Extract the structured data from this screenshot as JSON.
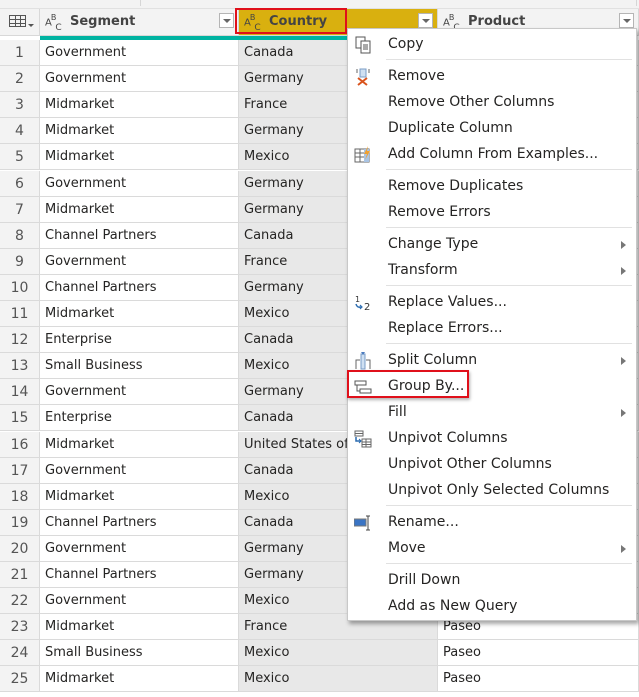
{
  "columns": [
    {
      "name": "Segment",
      "type_icon": "abc-text-type-icon"
    },
    {
      "name": "Country",
      "type_icon": "abc-text-type-icon",
      "selected": true
    },
    {
      "name": "Product",
      "type_icon": "abc-text-type-icon"
    }
  ],
  "type_label": {
    "a": "A",
    "b": "B",
    "c": "C"
  },
  "rows": [
    {
      "n": "1",
      "segment": "Government",
      "country": "Canada",
      "product": ""
    },
    {
      "n": "2",
      "segment": "Government",
      "country": "Germany",
      "product": ""
    },
    {
      "n": "3",
      "segment": "Midmarket",
      "country": "France",
      "product": ""
    },
    {
      "n": "4",
      "segment": "Midmarket",
      "country": "Germany",
      "product": ""
    },
    {
      "n": "5",
      "segment": "Midmarket",
      "country": "Mexico",
      "product": ""
    },
    {
      "n": "6",
      "segment": "Government",
      "country": "Germany",
      "product": ""
    },
    {
      "n": "7",
      "segment": "Midmarket",
      "country": "Germany",
      "product": ""
    },
    {
      "n": "8",
      "segment": "Channel Partners",
      "country": "Canada",
      "product": ""
    },
    {
      "n": "9",
      "segment": "Government",
      "country": "France",
      "product": ""
    },
    {
      "n": "10",
      "segment": "Channel Partners",
      "country": "Germany",
      "product": ""
    },
    {
      "n": "11",
      "segment": "Midmarket",
      "country": "Mexico",
      "product": ""
    },
    {
      "n": "12",
      "segment": "Enterprise",
      "country": "Canada",
      "product": ""
    },
    {
      "n": "13",
      "segment": "Small Business",
      "country": "Mexico",
      "product": ""
    },
    {
      "n": "14",
      "segment": "Government",
      "country": "Germany",
      "product": ""
    },
    {
      "n": "15",
      "segment": "Enterprise",
      "country": "Canada",
      "product": ""
    },
    {
      "n": "16",
      "segment": "Midmarket",
      "country": "United States of America",
      "product": ""
    },
    {
      "n": "17",
      "segment": "Government",
      "country": "Canada",
      "product": ""
    },
    {
      "n": "18",
      "segment": "Midmarket",
      "country": "Mexico",
      "product": ""
    },
    {
      "n": "19",
      "segment": "Channel Partners",
      "country": "Canada",
      "product": ""
    },
    {
      "n": "20",
      "segment": "Government",
      "country": "Germany",
      "product": ""
    },
    {
      "n": "21",
      "segment": "Channel Partners",
      "country": "Germany",
      "product": ""
    },
    {
      "n": "22",
      "segment": "Government",
      "country": "Mexico",
      "product": ""
    },
    {
      "n": "23",
      "segment": "Midmarket",
      "country": "France",
      "product": "Paseo"
    },
    {
      "n": "24",
      "segment": "Small Business",
      "country": "Mexico",
      "product": "Paseo"
    },
    {
      "n": "25",
      "segment": "Midmarket",
      "country": "Mexico",
      "product": "Paseo"
    }
  ],
  "context_menu": {
    "items": [
      {
        "label": "Copy",
        "icon": "copy-icon"
      },
      {
        "label": "Remove",
        "icon": "remove-column-icon"
      },
      {
        "label": "Remove Other Columns"
      },
      {
        "label": "Duplicate Column"
      },
      {
        "label": "Add Column From Examples...",
        "icon": "column-from-examples-icon"
      },
      {
        "label": "Remove Duplicates"
      },
      {
        "label": "Remove Errors"
      },
      {
        "label": "Change Type",
        "submenu": true
      },
      {
        "label": "Transform",
        "submenu": true
      },
      {
        "label": "Replace Values...",
        "icon": "replace-values-icon"
      },
      {
        "label": "Replace Errors..."
      },
      {
        "label": "Split Column",
        "icon": "split-column-icon",
        "submenu": true
      },
      {
        "label": "Group By...",
        "icon": "group-by-icon",
        "highlighted": true
      },
      {
        "label": "Fill",
        "submenu": true
      },
      {
        "label": "Unpivot Columns",
        "icon": "unpivot-columns-icon"
      },
      {
        "label": "Unpivot Other Columns"
      },
      {
        "label": "Unpivot Only Selected Columns"
      },
      {
        "label": "Rename...",
        "icon": "rename-icon"
      },
      {
        "label": "Move",
        "submenu": true
      },
      {
        "label": "Drill Down"
      },
      {
        "label": "Add as New Query"
      }
    ]
  },
  "colors": {
    "selected_header": "#d9b00f",
    "highlight_outline": "#e0101b",
    "column_quality_bar": "#00b3a1"
  }
}
